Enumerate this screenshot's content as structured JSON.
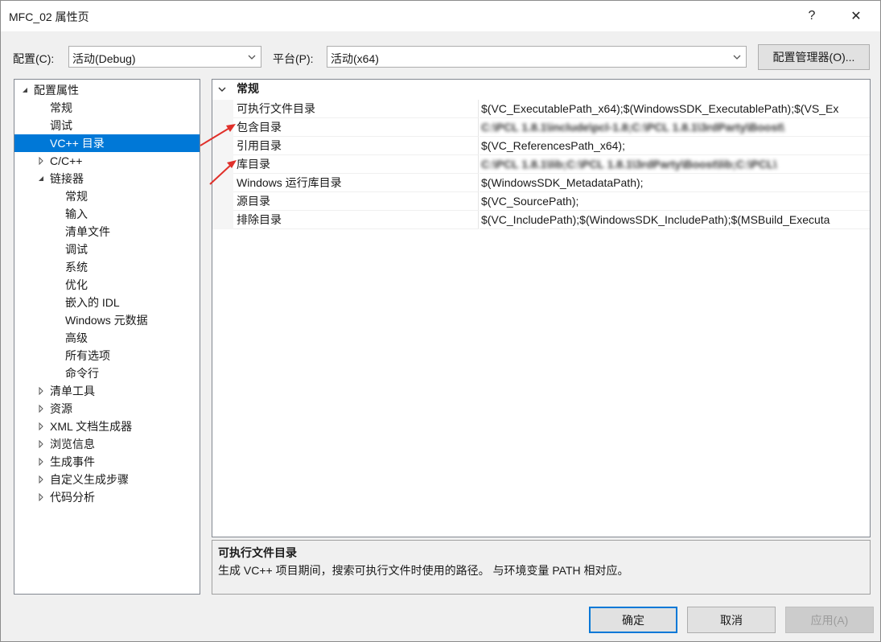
{
  "window": {
    "title": "MFC_02 属性页",
    "help": "?",
    "close": "✕"
  },
  "config": {
    "label": "配置(C):",
    "value": "活动(Debug)"
  },
  "platform": {
    "label": "平台(P):",
    "value": "活动(x64)"
  },
  "config_manager_button": "配置管理器(O)...",
  "tree": [
    {
      "label": "配置属性",
      "expander": "expanded"
    },
    {
      "label": "常规"
    },
    {
      "label": "调试"
    },
    {
      "label": "VC++ 目录",
      "selected": true
    },
    {
      "label": "C/C++",
      "expander": "collapsed"
    },
    {
      "label": "链接器",
      "expander": "expanded"
    },
    {
      "label": "常规"
    },
    {
      "label": "输入"
    },
    {
      "label": "清单文件"
    },
    {
      "label": "调试"
    },
    {
      "label": "系统"
    },
    {
      "label": "优化"
    },
    {
      "label": "嵌入的 IDL"
    },
    {
      "label": "Windows 元数据"
    },
    {
      "label": "高级"
    },
    {
      "label": "所有选项"
    },
    {
      "label": "命令行"
    },
    {
      "label": "清单工具",
      "expander": "collapsed"
    },
    {
      "label": "资源",
      "expander": "collapsed"
    },
    {
      "label": "XML 文档生成器",
      "expander": "collapsed"
    },
    {
      "label": "浏览信息",
      "expander": "collapsed"
    },
    {
      "label": "生成事件",
      "expander": "collapsed"
    },
    {
      "label": "自定义生成步骤",
      "expander": "collapsed"
    },
    {
      "label": "代码分析",
      "expander": "collapsed"
    }
  ],
  "grid": {
    "category": "常规",
    "rows": [
      {
        "name": "可执行文件目录",
        "value": "$(VC_ExecutablePath_x64);$(WindowsSDK_ExecutablePath);$(VS_Ex"
      },
      {
        "name": "包含目录",
        "value": "C:\\PCL 1.8.1\\include\\pcl-1.8;C:\\PCL 1.8.1\\3rdParty\\Boost\\",
        "bold": true,
        "blurred": true
      },
      {
        "name": "引用目录",
        "value": "$(VC_ReferencesPath_x64);"
      },
      {
        "name": "库目录",
        "value": "C:\\PCL 1.8.1\\lib;C:\\PCL 1.8.1\\3rdParty\\Boost\\lib;C:\\PCL\\",
        "bold": true,
        "blurred": true
      },
      {
        "name": "Windows 运行库目录",
        "value": "$(WindowsSDK_MetadataPath);"
      },
      {
        "name": "源目录",
        "value": "$(VC_SourcePath);"
      },
      {
        "name": "排除目录",
        "value": "$(VC_IncludePath);$(WindowsSDK_IncludePath);$(MSBuild_Executa"
      }
    ]
  },
  "description": {
    "title": "可执行文件目录",
    "text": "生成 VC++ 项目期间，搜索可执行文件时使用的路径。 与环境变量 PATH 相对应。"
  },
  "buttons": {
    "ok": "确定",
    "cancel": "取消",
    "apply": "应用(A)"
  },
  "colors": {
    "selection": "#0078d7",
    "annotation_arrow": "#e0302a"
  }
}
